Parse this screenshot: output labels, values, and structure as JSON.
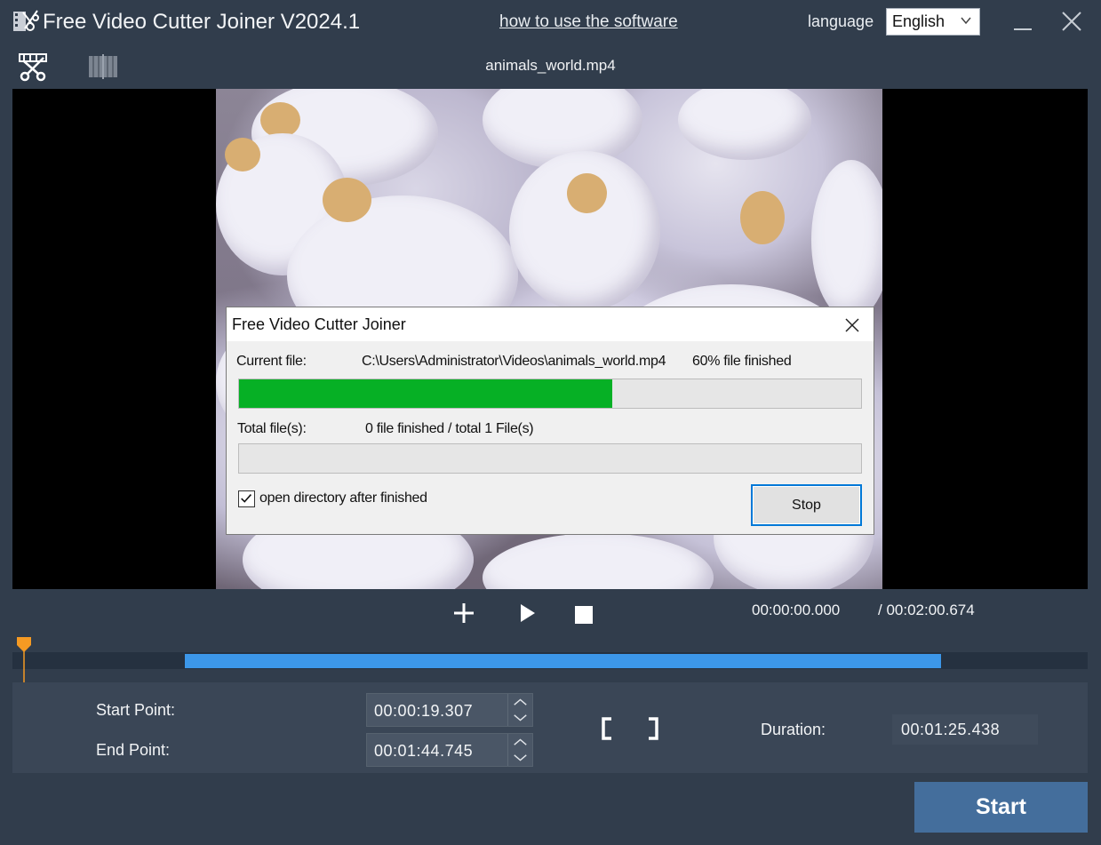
{
  "titlebar": {
    "app_title": "Free Video Cutter Joiner V2024.1",
    "help_link": "how to use the software",
    "language_label": "language",
    "language_selected": "English"
  },
  "toolbar": {
    "file_title": "animals_world.mp4"
  },
  "dialog": {
    "title": "Free Video Cutter Joiner",
    "current_file_label": "Current file:",
    "current_file_path": "C:\\Users\\Administrator\\Videos\\animals_world.mp4",
    "current_file_status": "60% file finished",
    "current_progress_percent": 60,
    "total_files_label": "Total file(s):",
    "total_files_status": "0 file finished / total 1 File(s)",
    "total_progress_percent": 0,
    "open_directory_label": "open directory after finished",
    "open_directory_checked": true,
    "stop_label": "Stop"
  },
  "playback": {
    "current_time": "00:00:00.000",
    "total_time": "/ 00:02:00.674"
  },
  "timeline": {
    "selection_start_fraction": 0.16,
    "selection_end_fraction": 0.864,
    "accent_color": "#3c97e9",
    "playhead_color": "#f59a23"
  },
  "settings": {
    "start_point_label": "Start Point:",
    "start_point_value": "00:00:19.307",
    "end_point_label": "End Point:",
    "end_point_value": "00:01:44.745",
    "duration_label": "Duration:",
    "duration_value": "00:01:25.438"
  },
  "actions": {
    "start_label": "Start"
  }
}
